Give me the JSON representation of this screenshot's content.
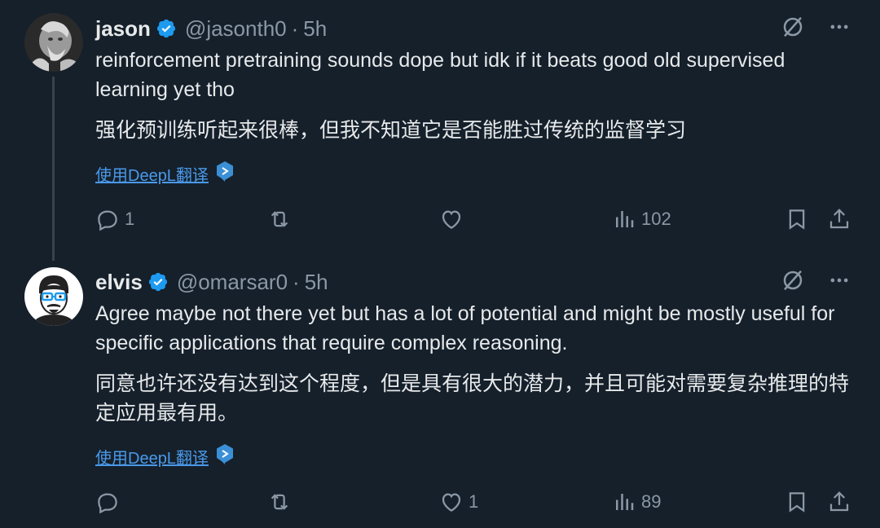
{
  "tweets": [
    {
      "display_name": "jason",
      "handle": "@jasonth0",
      "separator": "·",
      "time": "5h",
      "text_en": "reinforcement pretraining sounds dope but idk if it beats good old supervised learning yet tho",
      "text_zh": "强化预训练听起来很棒，但我不知道它是否能胜过传统的监督学习",
      "translate_label": "使用DeepL翻译",
      "replies": "1",
      "retweets": "",
      "likes": "",
      "views": "102"
    },
    {
      "display_name": "elvis",
      "handle": "@omarsar0",
      "separator": "·",
      "time": "5h",
      "text_en": "Agree maybe not there yet but has a lot of potential and might be mostly useful for specific applications that require complex reasoning.",
      "text_zh": "同意也许还没有达到这个程度，但是具有很大的潜力，并且可能对需要复杂推理的特定应用最有用。",
      "translate_label": "使用DeepL翻译",
      "replies": "",
      "retweets": "",
      "likes": "1",
      "views": "89"
    }
  ],
  "colors": {
    "background": "#15202b",
    "text_primary": "#e7e9ea",
    "text_secondary": "#8b98a5",
    "accent": "#1d9bf0",
    "thread_line": "#38444d"
  },
  "icons": [
    "verified-badge-icon",
    "grok-icon",
    "more-icon",
    "reply-icon",
    "retweet-icon",
    "like-icon",
    "views-icon",
    "bookmark-icon",
    "share-icon",
    "deepl-icon"
  ]
}
